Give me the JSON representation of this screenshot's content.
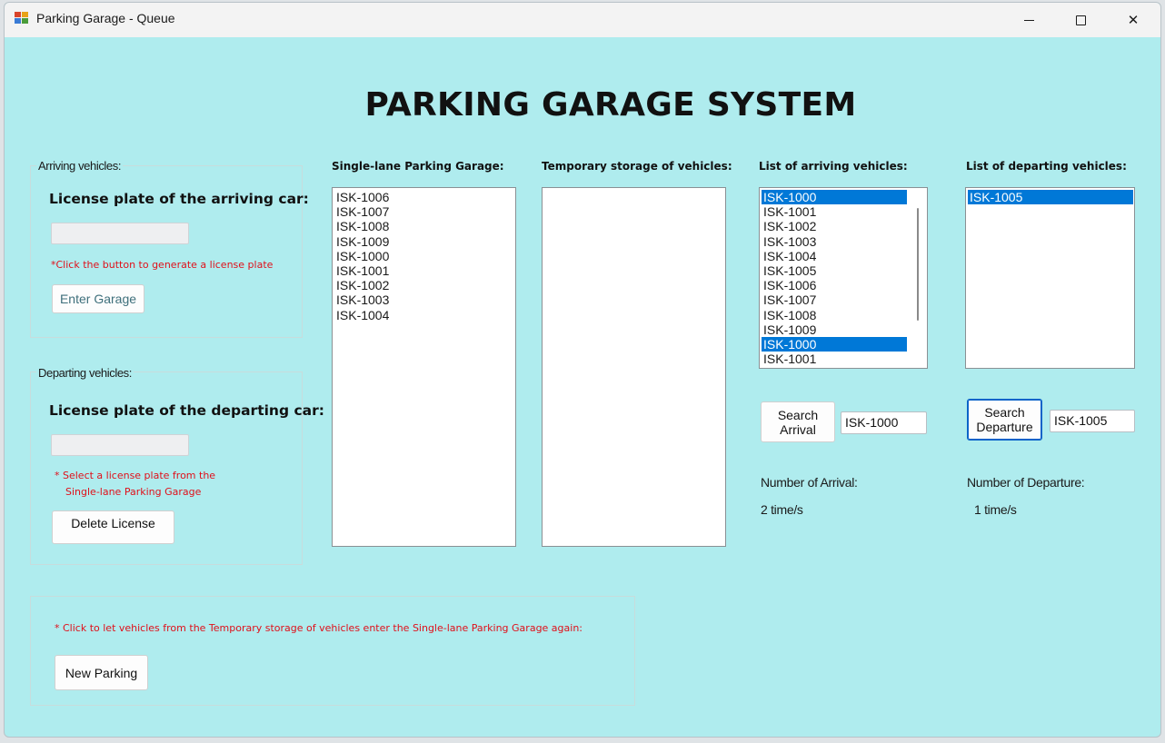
{
  "window": {
    "title": "Parking Garage - Queue",
    "controls": {
      "minimize": "minimize",
      "maximize": "maximize",
      "close": "✕"
    }
  },
  "main_title": "PARKING GARAGE SYSTEM",
  "arriving_group": {
    "label": "Arriving vehicles:",
    "heading": "License plate of the arriving car:",
    "plate_value": "",
    "hint": "*Click the button to generate a license plate",
    "enter_button": "Enter Garage"
  },
  "departing_group": {
    "label": "Departing vehicles:",
    "heading": "License plate of the departing car:",
    "plate_value": "",
    "hint_line1": "* Select a license plate from the",
    "hint_line2": "Single-lane Parking Garage",
    "delete_button": "Delete License"
  },
  "new_parking_group": {
    "hint": "* Click to let vehicles from the Temporary storage of vehicles enter the Single-lane Parking Garage again:",
    "button": "New Parking"
  },
  "garage": {
    "heading": "Single-lane Parking Garage:",
    "items": [
      "ISK-1006",
      "ISK-1007",
      "ISK-1008",
      "ISK-1009",
      "ISK-1000",
      "ISK-1001",
      "ISK-1002",
      "ISK-1003",
      "ISK-1004"
    ]
  },
  "temp_storage": {
    "heading": "Temporary storage of vehicles:",
    "items": []
  },
  "arrivals": {
    "heading": "List of arriving vehicles:",
    "items": [
      "ISK-1000",
      "ISK-1001",
      "ISK-1002",
      "ISK-1003",
      "ISK-1004",
      "ISK-1005",
      "ISK-1006",
      "ISK-1007",
      "ISK-1008",
      "ISK-1009",
      "ISK-1000",
      "ISK-1001"
    ],
    "selected_indices": [
      0,
      10
    ],
    "search_button_line1": "Search",
    "search_button_line2": "Arrival",
    "search_value": "ISK-1000",
    "count_label": "Number of Arrival:",
    "count_value": "2 time/s"
  },
  "departures": {
    "heading": "List of departing vehicles:",
    "items": [
      "ISK-1005"
    ],
    "selected_indices": [
      0
    ],
    "search_button_line1": "Search",
    "search_button_line2": "Departure",
    "search_value": "ISK-1005",
    "count_label": "Number of Departure:",
    "count_value": "1 time/s"
  },
  "colors": {
    "background": "#afecee",
    "selection": "#0078d7",
    "hint_red": "#e0101a"
  }
}
